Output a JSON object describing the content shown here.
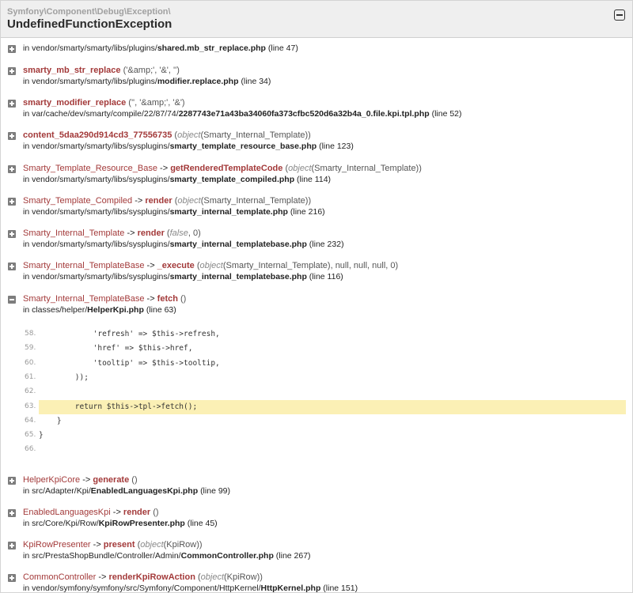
{
  "header": {
    "namespace": "Symfony\\Component\\Debug\\Exception\\",
    "title": "UndefinedFunctionException"
  },
  "traces": [
    {
      "class": "",
      "arrow": "",
      "method": "",
      "args": "",
      "in_prefix": "in vendor/smarty/smarty/libs/plugins/",
      "file": "shared.mb_str_replace.php",
      "line_text": "(line 47)"
    },
    {
      "class": "",
      "arrow": "",
      "method": "smarty_mb_str_replace",
      "args": "('&amp;', '&', '')",
      "in_prefix": "in vendor/smarty/smarty/libs/plugins/",
      "file": "modifier.replace.php",
      "line_text": "(line 34)"
    },
    {
      "class": "",
      "arrow": "",
      "method": "smarty_modifier_replace",
      "args": "('', '&amp;', '&')",
      "in_prefix": "in var/cache/dev/smarty/compile/22/87/74/",
      "file": "2287743e71a43ba34060fa373cfbc520d6a32b4a_0.file.kpi.tpl.php",
      "line_text": "(line 52)"
    },
    {
      "class": "",
      "arrow": "",
      "method": "content_5daa290d914cd3_77556735",
      "args_obj": "object",
      "args": "(Smarty_Internal_Template))",
      "in_prefix": "in vendor/smarty/smarty/libs/sysplugins/",
      "file": "smarty_template_resource_base.php",
      "line_text": "(line 123)"
    },
    {
      "class": "Smarty_Template_Resource_Base",
      "arrow": "->",
      "method": "getRenderedTemplateCode",
      "args_obj": "object",
      "args": "(Smarty_Internal_Template))",
      "in_prefix": "in vendor/smarty/smarty/libs/sysplugins/",
      "file": "smarty_template_compiled.php",
      "line_text": "(line 114)"
    },
    {
      "class": "Smarty_Template_Compiled",
      "arrow": "->",
      "method": "render",
      "args_obj": "object",
      "args": "(Smarty_Internal_Template))",
      "in_prefix": "in vendor/smarty/smarty/libs/sysplugins/",
      "file": "smarty_internal_template.php",
      "line_text": "(line 216)"
    },
    {
      "class": "Smarty_Internal_Template",
      "arrow": "->",
      "method": "render",
      "args_obj": "false",
      "args": ", 0)",
      "in_prefix": "in vendor/smarty/smarty/libs/sysplugins/",
      "file": "smarty_internal_templatebase.php",
      "line_text": "(line 232)"
    },
    {
      "class": "Smarty_Internal_TemplateBase",
      "arrow": "->",
      "method": "_execute",
      "args_obj": "object",
      "args": "(Smarty_Internal_Template), null, null, null, 0)",
      "in_prefix": "in vendor/smarty/smarty/libs/sysplugins/",
      "file": "smarty_internal_templatebase.php",
      "line_text": "(line 116)"
    },
    {
      "class": "Smarty_Internal_TemplateBase",
      "arrow": "->",
      "method": "fetch",
      "args": "()",
      "in_prefix": "in classes/helper/",
      "file": "HelperKpi.php",
      "line_text": "(line 63)",
      "expanded": true
    },
    {
      "class": "HelperKpiCore",
      "arrow": "->",
      "method": "generate",
      "args": "()",
      "in_prefix": "in src/Adapter/Kpi/",
      "file": "EnabledLanguagesKpi.php",
      "line_text": "(line 99)"
    },
    {
      "class": "EnabledLanguagesKpi",
      "arrow": "->",
      "method": "render",
      "args": "()",
      "in_prefix": "in src/Core/Kpi/Row/",
      "file": "KpiRowPresenter.php",
      "line_text": "(line 45)"
    },
    {
      "class": "KpiRowPresenter",
      "arrow": "->",
      "method": "present",
      "args_obj": "object",
      "args": "(KpiRow))",
      "in_prefix": "in src/PrestaShopBundle/Controller/Admin/",
      "file": "CommonController.php",
      "line_text": "(line 267)"
    },
    {
      "class": "CommonController",
      "arrow": "->",
      "method": "renderKpiRowAction",
      "args_obj": "object",
      "args": "(KpiRow))",
      "in_prefix": "in vendor/symfony/symfony/src/Symfony/Component/HttpKernel/",
      "file": "HttpKernel.php",
      "line_text": "(line 151)"
    }
  ],
  "code": [
    {
      "num": "58.",
      "text": "            'refresh' => $this->refresh,"
    },
    {
      "num": "59.",
      "text": "            'href' => $this->href,"
    },
    {
      "num": "60.",
      "text": "            'tooltip' => $this->tooltip,"
    },
    {
      "num": "61.",
      "text": "        ));"
    },
    {
      "num": "62.",
      "text": ""
    },
    {
      "num": "63.",
      "text": "        return $this->tpl->fetch();",
      "highlight": true
    },
    {
      "num": "64.",
      "text": "    }"
    },
    {
      "num": "65.",
      "text": "}"
    },
    {
      "num": "66.",
      "text": ""
    }
  ],
  "colors": {
    "header_bg": "#efefef",
    "method": "#a33a3a",
    "highlight": "#fbf0b5"
  },
  "icons": {
    "expand": "plus-square-icon",
    "collapse": "minus-square-icon"
  }
}
